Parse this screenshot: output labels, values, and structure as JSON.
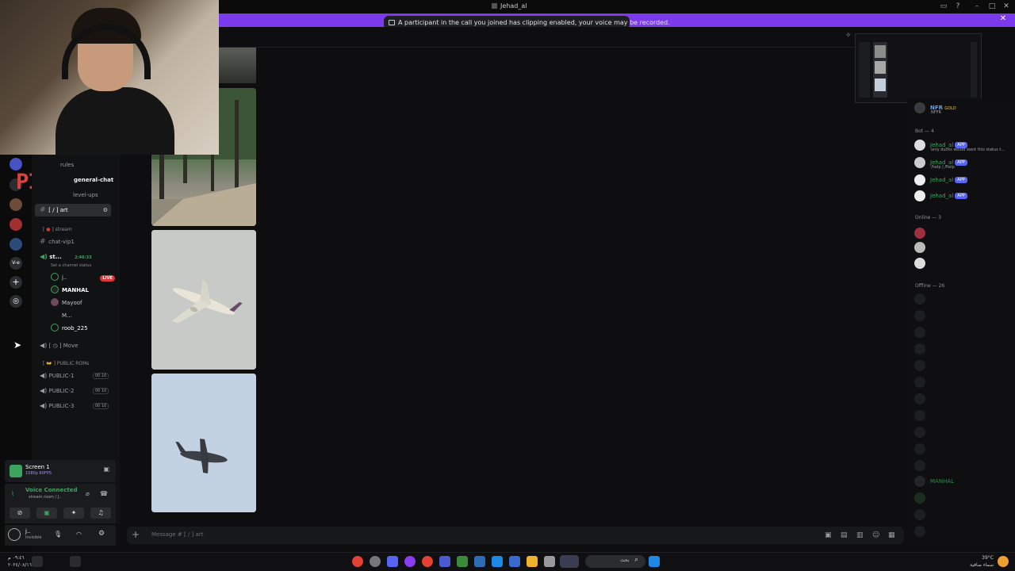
{
  "window": {
    "title": "Jehad_al"
  },
  "banner": {
    "message": "A participant in the call you joined has clipping enabled, your voice may be recorded."
  },
  "overlay_logo": {
    "text": "PIXL"
  },
  "channels": {
    "rules": "rules",
    "general": "general-chat",
    "levelups": "level-ups",
    "art_prefix": "[ / ]",
    "art": "art",
    "stream_category": "stream",
    "chat_vip": "chat-vip1",
    "stream_room": "st...",
    "stream_time": "2:46:33",
    "set_status": "Set a channel status",
    "move": "Move",
    "public_category": "PUBLIC ROMs",
    "public_1": "PUBLIC-1",
    "public_2": "PUBLIC-2",
    "public_3": "PUBLIC-3",
    "public_badge": "00 10"
  },
  "voice_users": [
    {
      "name": "j..",
      "live": "LIVE"
    },
    {
      "name": "MANHAL"
    },
    {
      "name": "Mayoof"
    },
    {
      "name": "M..."
    },
    {
      "name": "roob_225"
    }
  ],
  "screen_panel": {
    "title": "Screen 1",
    "subtitle": "1080p 60FPS"
  },
  "voice_panel": {
    "status": "Voice Connected",
    "room": "stream room / J.."
  },
  "user_panel": {
    "name": "j..",
    "status": "Invisible"
  },
  "message_input": {
    "placeholder": "Message # [ / ] art"
  },
  "members": {
    "top_name": "NFR",
    "top_tag": "GOLD",
    "top_sub": "NFFR",
    "bot_header": "Bot — 4",
    "bots": [
      {
        "name": "Jehad_al",
        "tag": "APP",
        "sub": "only ducks would want this status t..."
      },
      {
        "name": "Jehad_al",
        "tag": "APP",
        "sub": "/help | /help"
      },
      {
        "name": "Jehad_al",
        "tag": "APP",
        "sub": ""
      },
      {
        "name": "Jehad_al",
        "tag": "APP",
        "sub": ""
      }
    ],
    "online_header": "Online — 3",
    "offline_header": "Offline — 26",
    "offline_visible": [
      {
        "name": "MANHAL"
      }
    ]
  },
  "taskbar": {
    "time": "٠٩:٤٦ م",
    "date": "٢٠٢٤/٠٨/١٦",
    "search_label": "بحث",
    "weather_temp": "39°C",
    "weather_desc": "سماء صافية"
  },
  "colors": {
    "banner": "#7c3aed",
    "accent_green": "#3ba55d",
    "app_tag": "#5865f2",
    "live": "#da373c"
  }
}
